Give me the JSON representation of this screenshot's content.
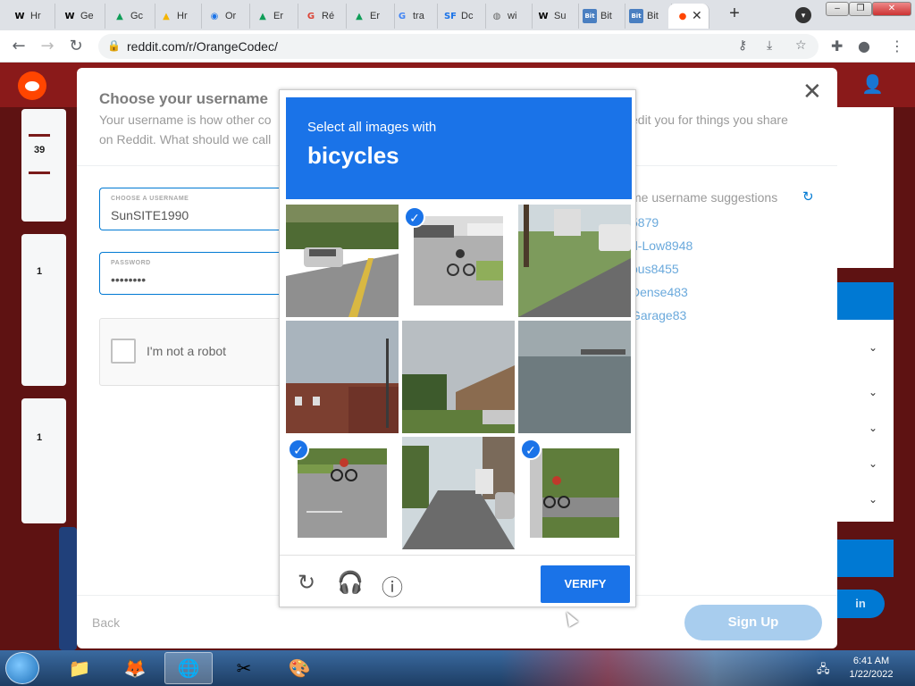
{
  "browser": {
    "tabs": [
      {
        "icon": "W",
        "label": "Hr"
      },
      {
        "icon": "W",
        "label": "Ge"
      },
      {
        "icon": "▲",
        "label": "Gc"
      },
      {
        "icon": "▲",
        "label": "Hr"
      },
      {
        "icon": "◉",
        "label": "Or"
      },
      {
        "icon": "▲",
        "label": "Er"
      },
      {
        "icon": "G",
        "label": "Ré"
      },
      {
        "icon": "▲",
        "label": "Er"
      },
      {
        "icon": "G",
        "label": "tra"
      },
      {
        "icon": "SF",
        "label": "Dc"
      },
      {
        "icon": "◍",
        "label": "wi"
      },
      {
        "icon": "W",
        "label": "Su"
      },
      {
        "icon": "Bit",
        "label": "Bit"
      },
      {
        "icon": "Bit",
        "label": "Bit"
      },
      {
        "icon": "●",
        "label": ""
      }
    ],
    "url": "reddit.com/r/OrangeCodec/",
    "colors": {
      "tabstrip": "#dee1e6",
      "omnibox": "#f1f3f4"
    }
  },
  "modal": {
    "title": "Choose your username",
    "subtitle_left": "Your username is how other co on Reddit. What should we call",
    "subtitle_right": "edit you for things you share",
    "username_label": "CHOOSE A USERNAME",
    "username_value": "SunSITE1990",
    "password_label": "PASSWORD",
    "password_value": "••••••••",
    "robot_label": "I'm not a robot",
    "suggestions_title": "me username suggestions",
    "suggestions": [
      "5879",
      "d-Low8948",
      "ous8455",
      "Dense483",
      "Garage83"
    ],
    "back_label": "Back",
    "signup_label": "Sign Up"
  },
  "captcha": {
    "line1": "Select all images with",
    "line2": "bicycles",
    "tiles": [
      {
        "scene": "road-with-car",
        "selected": false
      },
      {
        "scene": "cyclist-on-street",
        "selected": true
      },
      {
        "scene": "street-with-truck",
        "selected": false
      },
      {
        "scene": "brick-building",
        "selected": false
      },
      {
        "scene": "house-yard",
        "selected": false
      },
      {
        "scene": "river-water",
        "selected": false
      },
      {
        "scene": "cyclist-road",
        "selected": true
      },
      {
        "scene": "city-street",
        "selected": false
      },
      {
        "scene": "cyclist-grass",
        "selected": true
      }
    ],
    "verify_label": "VERIFY",
    "accent": "#1a73e8"
  },
  "page": {
    "vote_counts": [
      "39",
      "1",
      "1"
    ],
    "login_label": "in"
  },
  "taskbar": {
    "time": "6:41 AM",
    "date": "1/22/2022"
  }
}
